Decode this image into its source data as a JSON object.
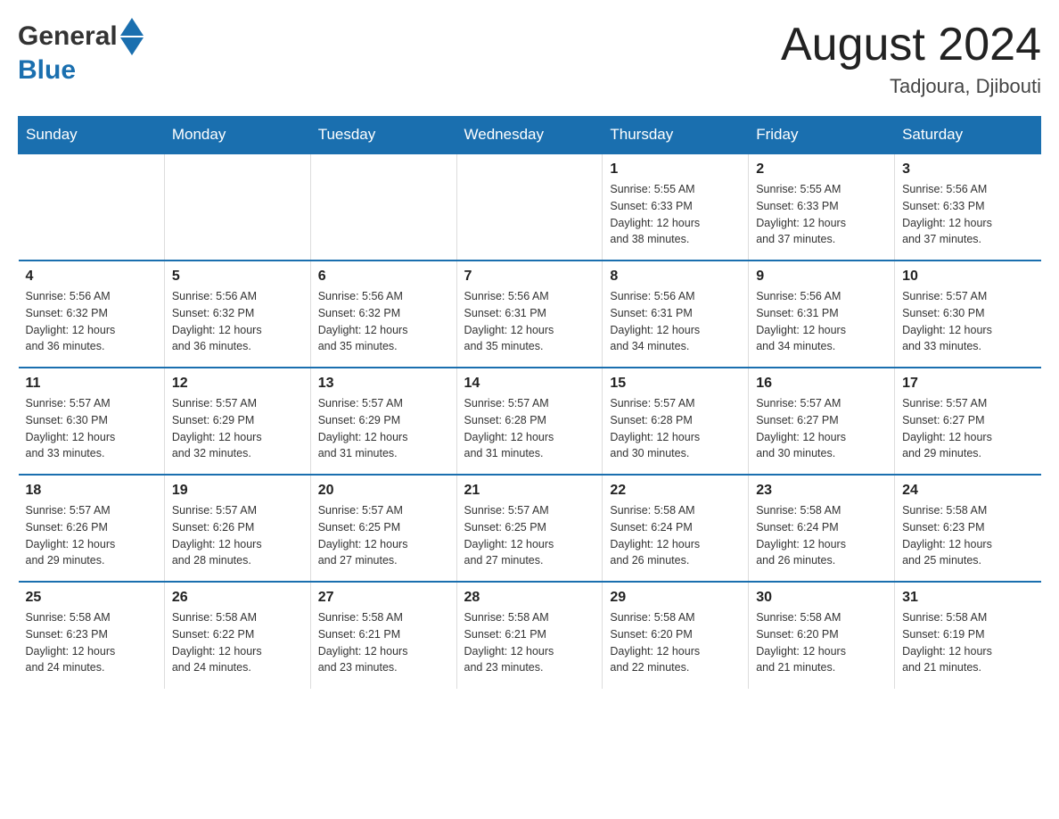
{
  "header": {
    "logo_general": "General",
    "logo_blue": "Blue",
    "title": "August 2024",
    "subtitle": "Tadjoura, Djibouti"
  },
  "days_of_week": [
    "Sunday",
    "Monday",
    "Tuesday",
    "Wednesday",
    "Thursday",
    "Friday",
    "Saturday"
  ],
  "weeks": [
    [
      {
        "day": "",
        "info": ""
      },
      {
        "day": "",
        "info": ""
      },
      {
        "day": "",
        "info": ""
      },
      {
        "day": "",
        "info": ""
      },
      {
        "day": "1",
        "info": "Sunrise: 5:55 AM\nSunset: 6:33 PM\nDaylight: 12 hours\nand 38 minutes."
      },
      {
        "day": "2",
        "info": "Sunrise: 5:55 AM\nSunset: 6:33 PM\nDaylight: 12 hours\nand 37 minutes."
      },
      {
        "day": "3",
        "info": "Sunrise: 5:56 AM\nSunset: 6:33 PM\nDaylight: 12 hours\nand 37 minutes."
      }
    ],
    [
      {
        "day": "4",
        "info": "Sunrise: 5:56 AM\nSunset: 6:32 PM\nDaylight: 12 hours\nand 36 minutes."
      },
      {
        "day": "5",
        "info": "Sunrise: 5:56 AM\nSunset: 6:32 PM\nDaylight: 12 hours\nand 36 minutes."
      },
      {
        "day": "6",
        "info": "Sunrise: 5:56 AM\nSunset: 6:32 PM\nDaylight: 12 hours\nand 35 minutes."
      },
      {
        "day": "7",
        "info": "Sunrise: 5:56 AM\nSunset: 6:31 PM\nDaylight: 12 hours\nand 35 minutes."
      },
      {
        "day": "8",
        "info": "Sunrise: 5:56 AM\nSunset: 6:31 PM\nDaylight: 12 hours\nand 34 minutes."
      },
      {
        "day": "9",
        "info": "Sunrise: 5:56 AM\nSunset: 6:31 PM\nDaylight: 12 hours\nand 34 minutes."
      },
      {
        "day": "10",
        "info": "Sunrise: 5:57 AM\nSunset: 6:30 PM\nDaylight: 12 hours\nand 33 minutes."
      }
    ],
    [
      {
        "day": "11",
        "info": "Sunrise: 5:57 AM\nSunset: 6:30 PM\nDaylight: 12 hours\nand 33 minutes."
      },
      {
        "day": "12",
        "info": "Sunrise: 5:57 AM\nSunset: 6:29 PM\nDaylight: 12 hours\nand 32 minutes."
      },
      {
        "day": "13",
        "info": "Sunrise: 5:57 AM\nSunset: 6:29 PM\nDaylight: 12 hours\nand 31 minutes."
      },
      {
        "day": "14",
        "info": "Sunrise: 5:57 AM\nSunset: 6:28 PM\nDaylight: 12 hours\nand 31 minutes."
      },
      {
        "day": "15",
        "info": "Sunrise: 5:57 AM\nSunset: 6:28 PM\nDaylight: 12 hours\nand 30 minutes."
      },
      {
        "day": "16",
        "info": "Sunrise: 5:57 AM\nSunset: 6:27 PM\nDaylight: 12 hours\nand 30 minutes."
      },
      {
        "day": "17",
        "info": "Sunrise: 5:57 AM\nSunset: 6:27 PM\nDaylight: 12 hours\nand 29 minutes."
      }
    ],
    [
      {
        "day": "18",
        "info": "Sunrise: 5:57 AM\nSunset: 6:26 PM\nDaylight: 12 hours\nand 29 minutes."
      },
      {
        "day": "19",
        "info": "Sunrise: 5:57 AM\nSunset: 6:26 PM\nDaylight: 12 hours\nand 28 minutes."
      },
      {
        "day": "20",
        "info": "Sunrise: 5:57 AM\nSunset: 6:25 PM\nDaylight: 12 hours\nand 27 minutes."
      },
      {
        "day": "21",
        "info": "Sunrise: 5:57 AM\nSunset: 6:25 PM\nDaylight: 12 hours\nand 27 minutes."
      },
      {
        "day": "22",
        "info": "Sunrise: 5:58 AM\nSunset: 6:24 PM\nDaylight: 12 hours\nand 26 minutes."
      },
      {
        "day": "23",
        "info": "Sunrise: 5:58 AM\nSunset: 6:24 PM\nDaylight: 12 hours\nand 26 minutes."
      },
      {
        "day": "24",
        "info": "Sunrise: 5:58 AM\nSunset: 6:23 PM\nDaylight: 12 hours\nand 25 minutes."
      }
    ],
    [
      {
        "day": "25",
        "info": "Sunrise: 5:58 AM\nSunset: 6:23 PM\nDaylight: 12 hours\nand 24 minutes."
      },
      {
        "day": "26",
        "info": "Sunrise: 5:58 AM\nSunset: 6:22 PM\nDaylight: 12 hours\nand 24 minutes."
      },
      {
        "day": "27",
        "info": "Sunrise: 5:58 AM\nSunset: 6:21 PM\nDaylight: 12 hours\nand 23 minutes."
      },
      {
        "day": "28",
        "info": "Sunrise: 5:58 AM\nSunset: 6:21 PM\nDaylight: 12 hours\nand 23 minutes."
      },
      {
        "day": "29",
        "info": "Sunrise: 5:58 AM\nSunset: 6:20 PM\nDaylight: 12 hours\nand 22 minutes."
      },
      {
        "day": "30",
        "info": "Sunrise: 5:58 AM\nSunset: 6:20 PM\nDaylight: 12 hours\nand 21 minutes."
      },
      {
        "day": "31",
        "info": "Sunrise: 5:58 AM\nSunset: 6:19 PM\nDaylight: 12 hours\nand 21 minutes."
      }
    ]
  ]
}
